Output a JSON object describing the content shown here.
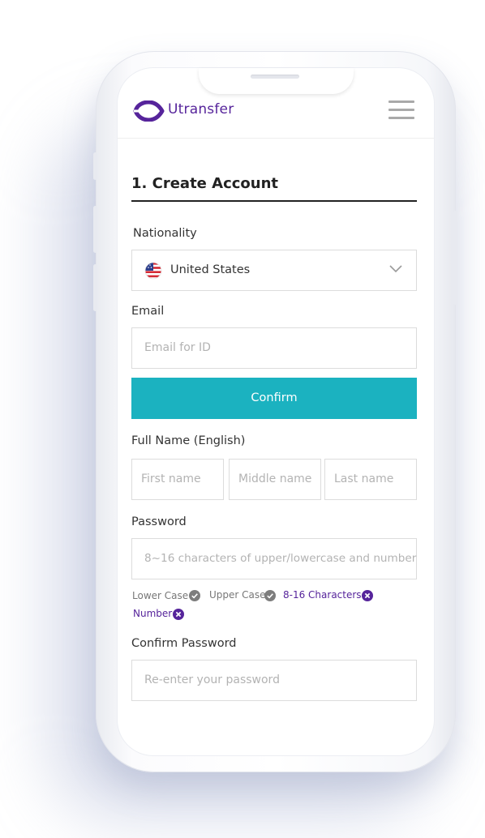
{
  "colors": {
    "brand": "#56249b",
    "accent": "#1bb2c0",
    "valid": "#777777",
    "invalid": "#56249b"
  },
  "header": {
    "logo_text": "Utransfer",
    "logo_icon": "utransfer-logo-icon",
    "menu_icon": "hamburger-menu-icon"
  },
  "form": {
    "title": "1. Create Account",
    "nationality": {
      "label": "Nationality",
      "value": "United States",
      "flag_icon": "us-flag-icon",
      "dropdown_icon": "chevron-down-icon"
    },
    "email": {
      "label": "Email",
      "placeholder": "Email for ID"
    },
    "confirm_button": "Confirm",
    "full_name": {
      "label": "Full Name (English)",
      "first_placeholder": "First name",
      "middle_placeholder": "Middle name",
      "last_placeholder": "Last name"
    },
    "password": {
      "label": "Password",
      "placeholder": "8~16 characters of upper/lowercase and number",
      "rules": [
        {
          "label": "Lower Case",
          "valid": true
        },
        {
          "label": "Upper Case",
          "valid": true
        },
        {
          "label": "8-16 Characters",
          "valid": false
        },
        {
          "label": "Number",
          "valid": false
        }
      ]
    },
    "confirm_password": {
      "label": "Confirm Password",
      "placeholder": "Re-enter your password"
    }
  }
}
